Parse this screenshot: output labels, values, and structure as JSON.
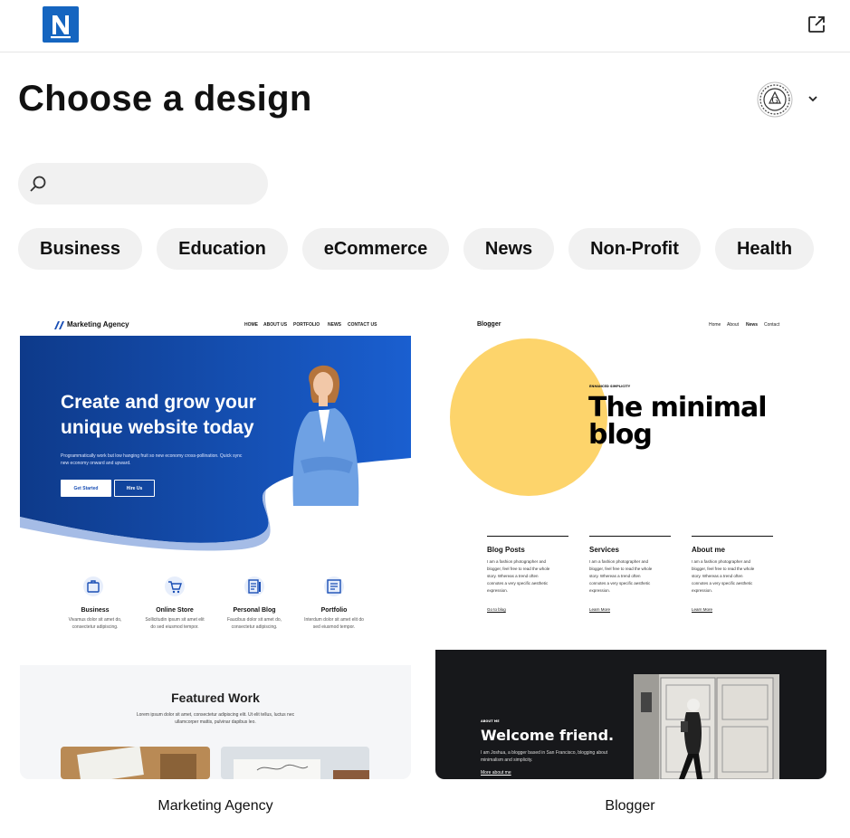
{
  "header": {
    "logo_letter": "N",
    "logo_color": "#1565c0"
  },
  "page": {
    "title": "Choose a design"
  },
  "search": {
    "placeholder": "",
    "value": ""
  },
  "categories": [
    "Business",
    "Education",
    "eCommerce",
    "News",
    "Non-Profit",
    "Health"
  ],
  "designs": [
    {
      "label": "Marketing Agency",
      "preview": {
        "brand": "Marketing Agency",
        "nav": [
          "HOME",
          "ABOUT US",
          "PORTFOLIO",
          "NEWS",
          "CONTACT US"
        ],
        "hero_title_1": "Create and grow your",
        "hero_title_2": "unique website today",
        "hero_text_1": "Programmatically work but low hanging fruit so new economy cross-pollination. Quick sync",
        "hero_text_2": "new economy onward and upward.",
        "btn_primary": "Get Started",
        "btn_secondary": "Hire Us",
        "features": [
          {
            "title": "Business",
            "line1": "Vivamus dolor sit amet do,",
            "line2": "consectetur adipiscing."
          },
          {
            "title": "Online Store",
            "line1": "Sollicitudin ipsum sit amet elit",
            "line2": "do sed eiusmod tempor."
          },
          {
            "title": "Personal Blog",
            "line1": "Faucibus dolor sit amet do,",
            "line2": "consectetur adipiscing."
          },
          {
            "title": "Portfolio",
            "line1": "Interdum dolor sit amet elit do",
            "line2": "sed eiusmod tempor."
          }
        ],
        "featured_title": "Featured Work",
        "featured_text_1": "Lorem ipsum dolor sit amet, consectetur adipiscing elit. Ut elit tellus, luctus nec",
        "featured_text_2": "ullamcorper mattis, pulvinar dapibus leo.",
        "accent": "#1a4fb5"
      }
    },
    {
      "label": "Blogger",
      "preview": {
        "brand": "Blogger",
        "nav": [
          "Home",
          "About",
          "News",
          "Contact"
        ],
        "kicker": "ENHANCED SIMPLICITY",
        "hero_title_1": "The minimal",
        "hero_title_2": "blog",
        "columns": [
          {
            "title": "Blog Posts",
            "lines": [
              "I am a fashion photographer and",
              "blogger, feel free to read the whole",
              "story. Whereas a trend often",
              "connotes a very specific aesthetic",
              "expression."
            ],
            "link": "Go to blog"
          },
          {
            "title": "Services",
            "lines": [
              "I am a fashion photographer and",
              "blogger, feel free to read the whole",
              "story. Whereas a trend often",
              "connotes a very specific aesthetic",
              "expression."
            ],
            "link": "Learn More"
          },
          {
            "title": "About me",
            "lines": [
              "I am a fashion photographer and",
              "blogger, feel free to read the whole",
              "story. Whereas a trend often",
              "connotes a very specific aesthetic",
              "expression."
            ],
            "link": "Learn More"
          }
        ],
        "about_kicker": "ABOUT ME",
        "welcome": "Welcome friend.",
        "welcome_text_1": "I am Joshua, a blogger based in San Francisco, blogging about",
        "welcome_text_2": "minimalism and simplicity.",
        "welcome_link": "More about me",
        "circle_color": "#fdd46b"
      }
    }
  ]
}
